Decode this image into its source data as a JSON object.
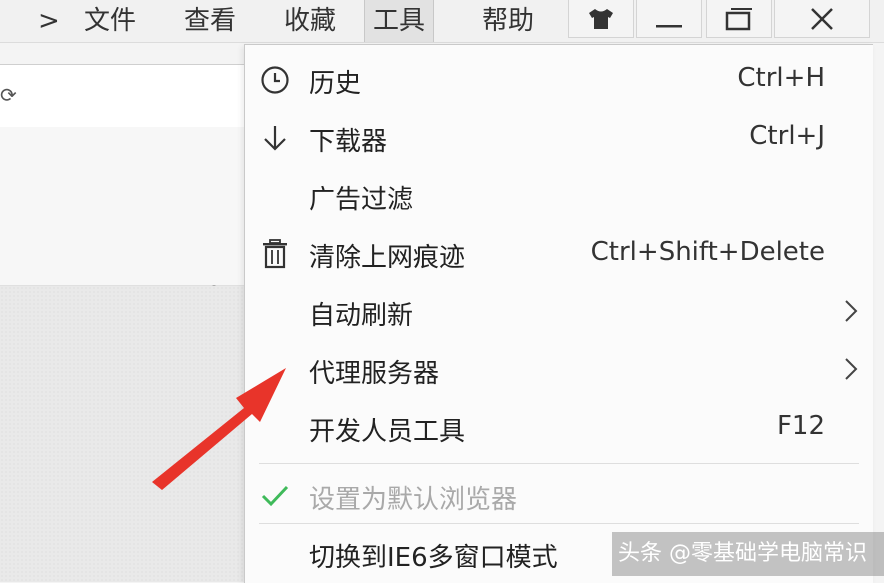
{
  "menubar": {
    "items": [
      {
        "label": "文件"
      },
      {
        "label": "查看"
      },
      {
        "label": "收藏"
      },
      {
        "label": "工具"
      },
      {
        "label": "帮助"
      }
    ],
    "window_buttons": [
      "skin-icon",
      "minimize-icon",
      "restore-icon",
      "close-icon"
    ]
  },
  "dropdown": {
    "items": [
      {
        "label": "历史",
        "shortcut": "Ctrl+H",
        "icon": "clock-icon"
      },
      {
        "label": "下载器",
        "shortcut": "Ctrl+J",
        "icon": "download-arrow-icon"
      },
      {
        "label": "广告过滤",
        "shortcut": ""
      },
      {
        "label": "清除上网痕迹",
        "shortcut": "Ctrl+Shift+Delete",
        "icon": "trash-icon"
      },
      {
        "label": "自动刷新",
        "submenu": true
      },
      {
        "label": "代理服务器",
        "submenu": true
      },
      {
        "label": "开发人员工具",
        "shortcut": "F12"
      },
      {
        "label": "设置为默认浏览器",
        "checked": true,
        "disabled": true
      },
      {
        "label": "切换到IE6多窗口模式"
      }
    ]
  },
  "watermark": "头条 @零基础学电脑常识",
  "colors": {
    "accent_arrow": "#e8342a",
    "check": "#3fba5a",
    "menu_bg": "#fbfbfb",
    "disabled_text": "#a9a9a9"
  }
}
